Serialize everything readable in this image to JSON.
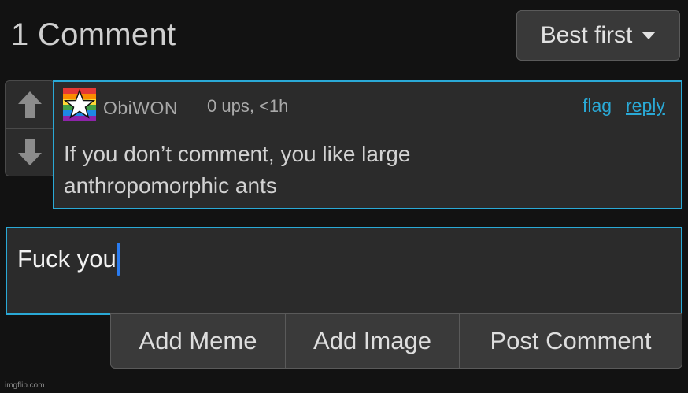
{
  "header": {
    "title": "1 Comment",
    "sort_label": "Best first"
  },
  "comment": {
    "username": "ObiWON",
    "meta": "0 ups, <1h",
    "flag_label": "flag",
    "reply_label": "reply",
    "text": "If you don’t comment, you like large anthropomorphic ants"
  },
  "reply_input": {
    "value": "Fuck you"
  },
  "actions": {
    "add_meme": "Add Meme",
    "add_image": "Add Image",
    "post_comment": "Post Comment"
  },
  "watermark": "imgflip.com",
  "colors": {
    "accent": "#2aa9d6",
    "background": "#121212",
    "panel": "#2b2b2b"
  },
  "icons": {
    "upvote": "arrow-up-icon",
    "downvote": "arrow-down-icon",
    "sort": "caret-down-icon"
  }
}
